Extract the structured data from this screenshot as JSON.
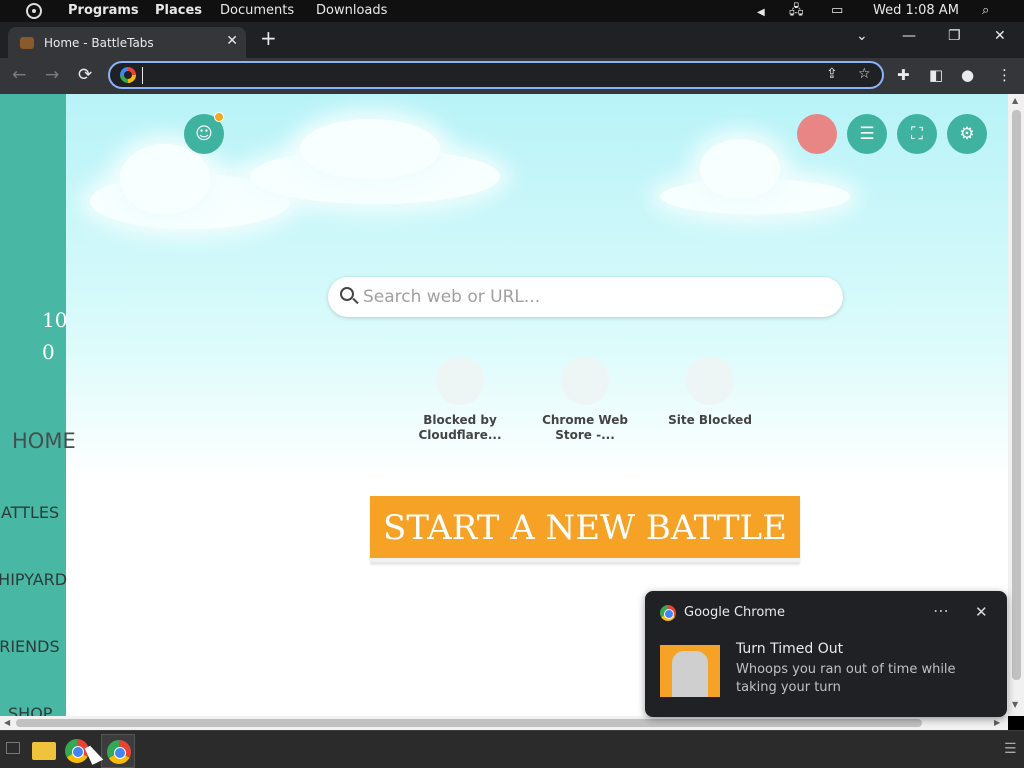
{
  "top_panel": {
    "menu": [
      "Programs",
      "Places",
      "Documents",
      "Downloads"
    ],
    "clock": "Wed 1:08 AM"
  },
  "browser": {
    "tab_title": "Home - BattleTabs",
    "tab_close": "✕",
    "new_tab": "+",
    "window_controls": [
      "⌄",
      "—",
      "❐",
      "✕"
    ],
    "nav": {
      "back": "←",
      "forward": "→",
      "reload": "⟳"
    },
    "omnibox_value": "",
    "extensions": [
      "share-icon",
      "star-icon",
      "puzzle-icon",
      "side-panel-icon",
      "profile-icon",
      "menu-icon"
    ]
  },
  "page": {
    "sidebar": {
      "count": "100",
      "items": [
        "HOME",
        "BATTLES",
        "SHIPYARD",
        "FRIENDS",
        "SHOP"
      ]
    },
    "search_placeholder": "Search web or URL...",
    "shortcuts": [
      {
        "label": "Blocked by Cloudflare..."
      },
      {
        "label": "Chrome Web Store -..."
      },
      {
        "label": "Site Blocked"
      }
    ],
    "start_button": "START A NEW BATTLE",
    "colors": {
      "accent": "#3fb3a0",
      "start": "#f5a227",
      "avatar": "#e88686"
    }
  },
  "notification": {
    "app": "Google Chrome",
    "more": "⋯",
    "close": "✕",
    "title": "Turn Timed Out",
    "body": "Whoops you ran out of time while taking your turn"
  }
}
